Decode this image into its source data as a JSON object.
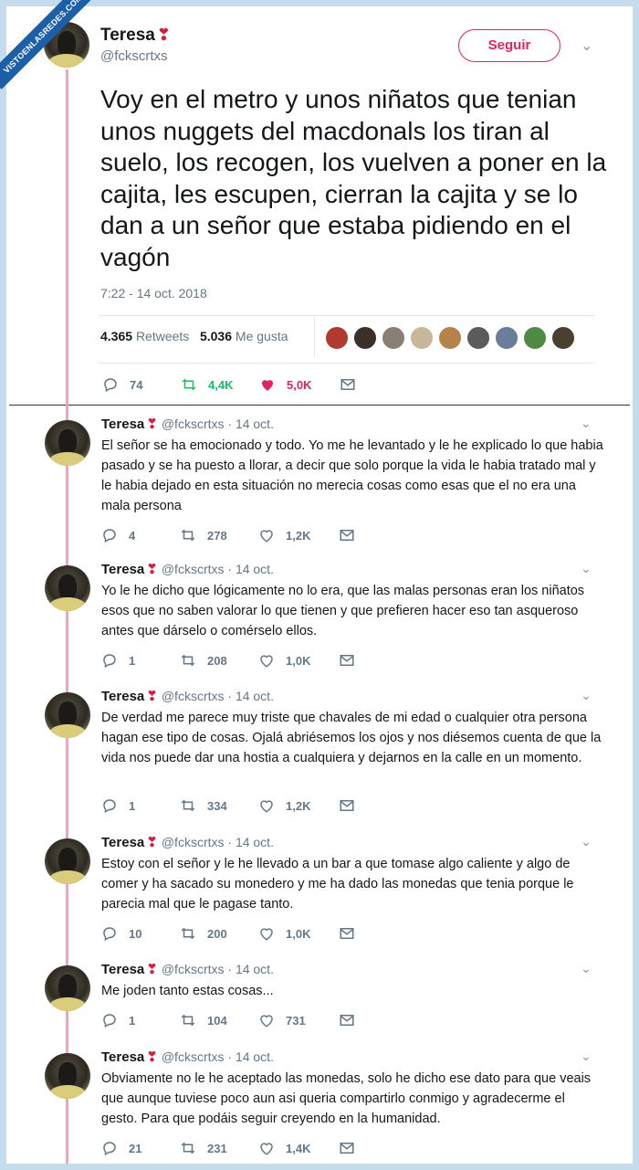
{
  "watermark": "VISTOENLASREDES.COM",
  "main_tweet": {
    "name": "Teresa",
    "handle": "@fckscrtxs",
    "follow_label": "Seguir",
    "text": "Voy en el metro y unos niñatos que tenian unos nuggets del macdonals los tiran al suelo, los recogen, los vuelven a poner en la cajita, les escupen, cierran la cajita y se lo dan a un señor que estaba pidiendo en el vagón",
    "date": "7:22 - 14 oct. 2018",
    "retweets_count": "4.365",
    "retweets_label": "Retweets",
    "likes_count": "5.036",
    "likes_label": "Me gusta",
    "replies": "74",
    "retweets_short": "4,4K",
    "likes_short": "5,0K"
  },
  "replies": [
    {
      "name": "Teresa",
      "handle": "@fckscrtxs · 14 oct.",
      "text": "El señor se ha emocionado y todo. Yo me he levantado y le he explicado lo que habia pasado y se ha puesto a llorar, a decir que solo porque la vida le habia tratado mal y le habia dejado en esta situación no merecia cosas como esas que el no era una mala persona",
      "replies": "4",
      "retweets": "278",
      "likes": "1,2K"
    },
    {
      "name": "Teresa",
      "handle": "@fckscrtxs · 14 oct.",
      "text": "Yo le he dicho que lógicamente no lo era, que las malas personas eran los niñatos esos que no saben valorar lo que tienen y que prefieren hacer eso tan asqueroso antes que dárselo o comérselo ellos.",
      "replies": "1",
      "retweets": "208",
      "likes": "1,0K"
    },
    {
      "name": "Teresa",
      "handle": "@fckscrtxs · 14 oct.",
      "text": "De verdad me parece muy triste que chavales de mi  edad o cualquier otra persona hagan ese tipo de cosas.  Ojalá abriésemos los ojos y nos diésemos cuenta de que la vida nos puede dar una hostia a cualquiera y dejarnos en la calle en un momento.",
      "replies": "1",
      "retweets": "334",
      "likes": "1,2K"
    },
    {
      "name": "Teresa",
      "handle": "@fckscrtxs · 14 oct.",
      "text": "Estoy con el señor y le he llevado a un bar a que tomase algo caliente y algo de comer y ha sacado su monedero y me ha dado las monedas que tenia porque le parecia mal que le pagase tanto.",
      "replies": "10",
      "retweets": "200",
      "likes": "1,0K"
    },
    {
      "name": "Teresa",
      "handle": "@fckscrtxs · 14 oct.",
      "text": "Me joden tanto estas cosas...",
      "replies": "1",
      "retweets": "104",
      "likes": "731"
    },
    {
      "name": "Teresa",
      "handle": "@fckscrtxs · 14 oct.",
      "text": "Obviamente no le he aceptado las monedas, solo he dicho ese dato para que veais que aunque tuviese poco aun asi queria compartirlo conmigo y agradecerme el gesto. Para que podáis seguir creyendo en la humanidad.",
      "replies": "21",
      "retweets": "231",
      "likes": "1,4K"
    }
  ],
  "colors": {
    "accent": "#e0245e",
    "retweet_green": "#17bf63",
    "thread_line": "#e8a7bd",
    "frame": "#c4dcec",
    "muted": "#657786"
  },
  "icons": [
    "reply-icon",
    "retweet-icon",
    "heart-icon",
    "message-icon",
    "chevron-down-icon"
  ]
}
